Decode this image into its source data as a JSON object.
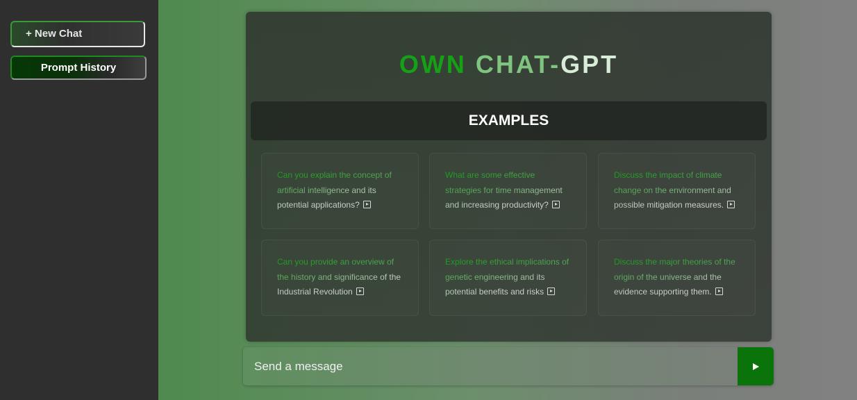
{
  "sidebar": {
    "new_chat_label": "+ New Chat",
    "prompt_history_label": "Prompt History"
  },
  "header": {
    "title_part1": "OWN",
    "title_part2": "CHAT-",
    "title_part3": "GPT"
  },
  "examples": {
    "heading": "EXAMPLES",
    "cards": [
      {
        "text": "Can you explain the concept of artificial intelligence and its potential applications?"
      },
      {
        "text": "What are some effective strategies for time management and increasing productivity?"
      },
      {
        "text": "Discuss the impact of climate change on the environment and possible mitigation measures."
      },
      {
        "text": "Can you provide an overview of the history and significance of the Industrial Revolution"
      },
      {
        "text": "Explore the ethical implications of genetic engineering and its potential benefits and risks"
      },
      {
        "text": "Discuss the major theories of the origin of the universe and the evidence supporting them."
      }
    ]
  },
  "composer": {
    "placeholder": "Send a message"
  },
  "colors": {
    "accent_green": "#16a016",
    "send_button": "#0a740a",
    "sidebar_bg": "#2f2f2f"
  },
  "icons": {
    "card_action": "play-box-icon",
    "send": "send-arrow-icon"
  }
}
